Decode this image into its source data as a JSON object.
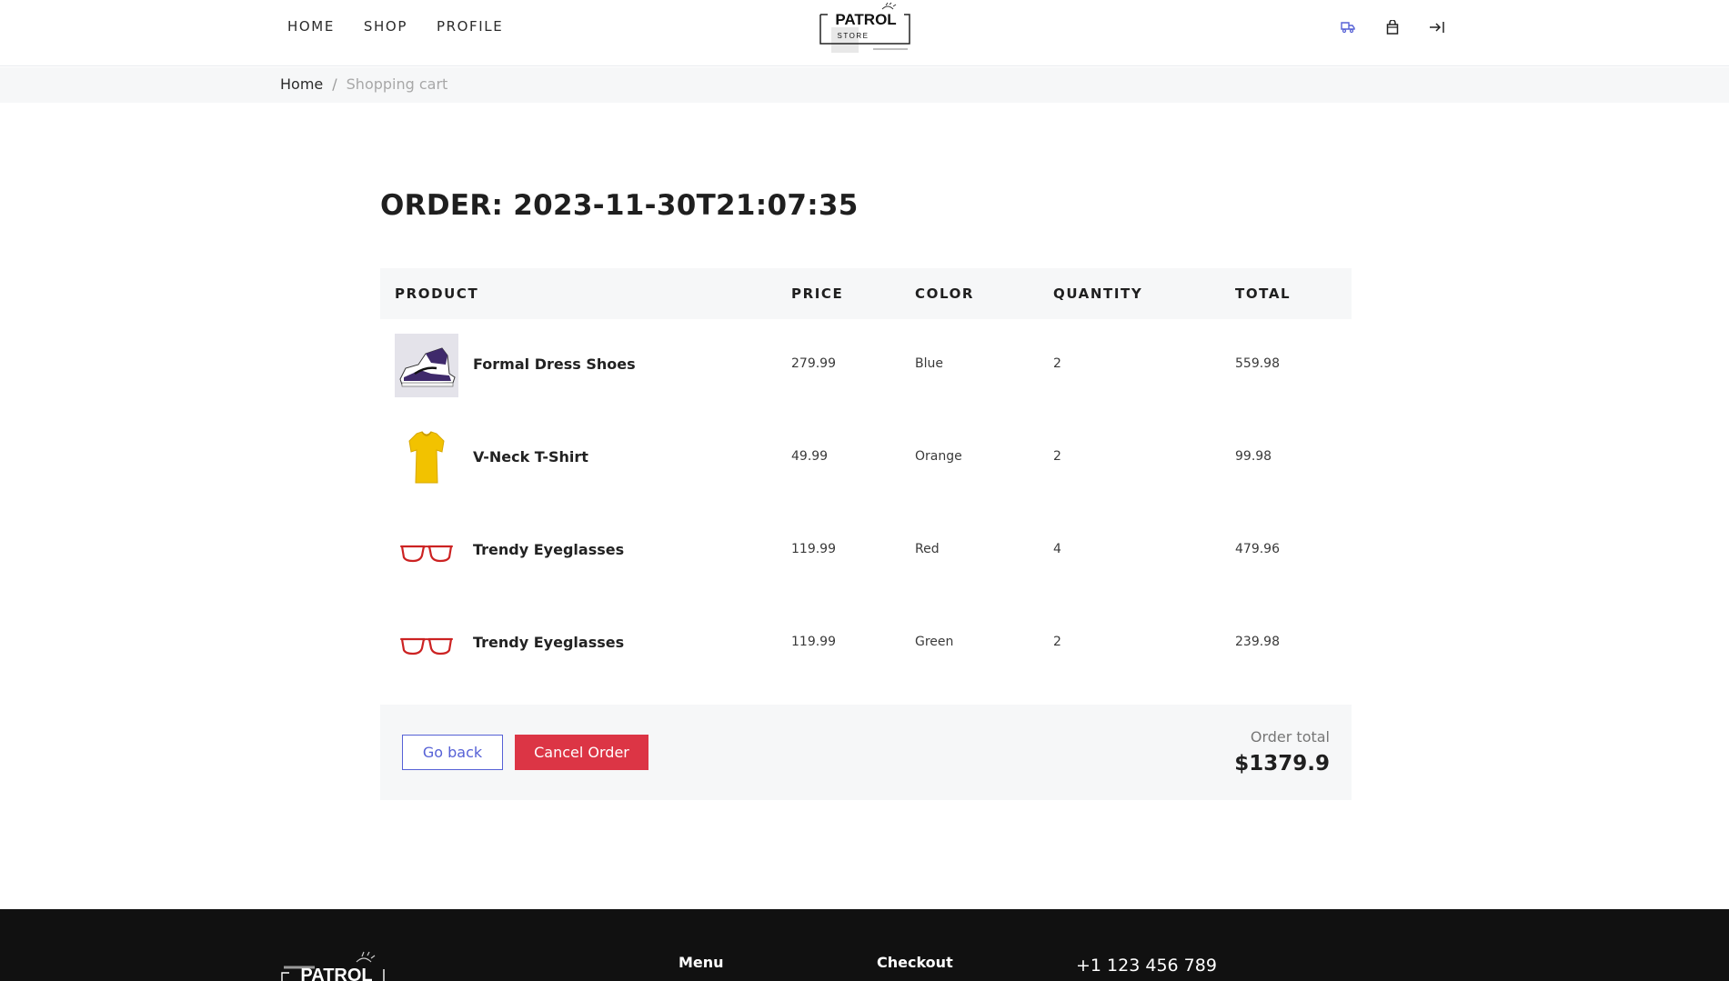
{
  "header": {
    "nav": [
      "HOME",
      "SHOP",
      "PROFILE"
    ],
    "logo_text": "PATROL",
    "logo_sub": "STORE",
    "icons": [
      "truck-icon",
      "shopping-bag-icon",
      "logout-icon"
    ]
  },
  "breadcrumb": {
    "home": "Home",
    "separator": "/",
    "current": "Shopping cart"
  },
  "order": {
    "title": "ORDER: 2023-11-30T21:07:35"
  },
  "table": {
    "headers": [
      "PRODUCT",
      "PRICE",
      "COLOR",
      "QUANTITY",
      "TOTAL"
    ],
    "rows": [
      {
        "name": "Formal Dress Shoes",
        "price": "279.99",
        "color": "Blue",
        "quantity": "2",
        "total": "559.98",
        "thumb": "sneaker-image"
      },
      {
        "name": "V-Neck T-Shirt",
        "price": "49.99",
        "color": "Orange",
        "quantity": "2",
        "total": "99.98",
        "thumb": "yellow-shirt-image"
      },
      {
        "name": "Trendy Eyeglasses",
        "price": "119.99",
        "color": "Red",
        "quantity": "4",
        "total": "479.96",
        "thumb": "red-eyeglasses-image"
      },
      {
        "name": "Trendy Eyeglasses",
        "price": "119.99",
        "color": "Green",
        "quantity": "2",
        "total": "239.98",
        "thumb": "red-eyeglasses-image"
      }
    ]
  },
  "summary": {
    "back_label": "Go back",
    "cancel_label": "Cancel Order",
    "total_label": "Order total",
    "total_value": "$1379.9"
  },
  "footer": {
    "logo_text": "PATROL",
    "menu_heading": "Menu",
    "checkout_heading": "Checkout",
    "phone": "+1 123 456 789"
  },
  "colors": {
    "accent": "#5661d6",
    "danger": "#dc3545",
    "band": "#f6f7f8",
    "footer": "#111111"
  }
}
